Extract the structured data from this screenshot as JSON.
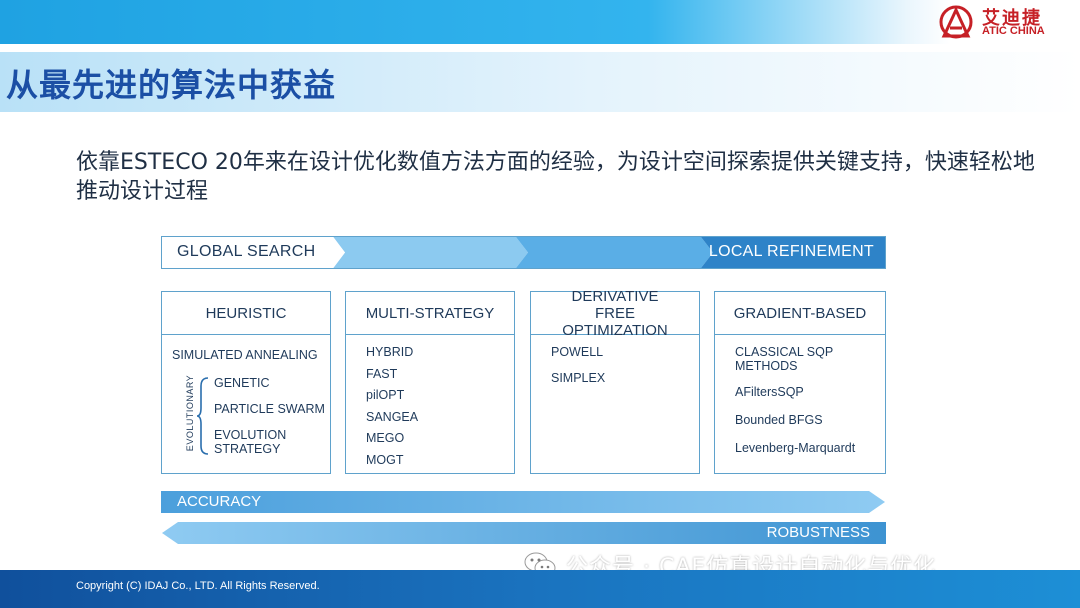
{
  "brand": {
    "logo_cn": "艾迪捷",
    "logo_en": "ATIC CHINA",
    "logo_red": "#c62026"
  },
  "slide": {
    "title": "从最先进的算法中获益",
    "intro": "依靠ESTECO 20年来在设计优化数值方法方面的经验，为设计空间探索提供关键支持，快速轻松地推动设计过程"
  },
  "search_strip": {
    "left_label": "GLOBAL SEARCH",
    "right_label": "LOCAL REFINEMENT"
  },
  "categories": {
    "heuristic": {
      "title": "HEURISTIC",
      "first_item": "SIMULATED ANNEALING",
      "group_label": "EVOLUTIONARY",
      "group_items": [
        "GENETIC",
        "PARTICLE SWARM",
        "EVOLUTION STRATEGY"
      ]
    },
    "multi_strategy": {
      "title": "MULTI-STRATEGY",
      "items": [
        "HYBRID",
        "FAST",
        "pilOPT",
        "SANGEA",
        "MEGO",
        "MOGT"
      ]
    },
    "derivative_free": {
      "title": "DERIVATIVE FREE OPTIMIZATION",
      "items": [
        "POWELL",
        "SIMPLEX"
      ]
    },
    "gradient_based": {
      "title": "GRADIENT-BASED",
      "items": [
        "CLASSICAL SQP METHODS",
        "AFiltersSQP",
        "Bounded BFGS",
        "Levenberg-Marquardt"
      ]
    }
  },
  "arrows": {
    "accuracy": "ACCURACY",
    "robustness": "ROBUSTNESS"
  },
  "watermark": {
    "icon": "wechat-icon",
    "text": "公众号 · CAE仿真设计自动化与优化"
  },
  "footer": {
    "copyright": "Copyright (C) IDAJ Co., LTD. All Rights Reserved."
  },
  "colors": {
    "primary_blue": "#1b4fa5",
    "light_blue": "#7fc1ec",
    "mid_blue": "#3d93d2",
    "dark_blue": "#2a6ead"
  }
}
